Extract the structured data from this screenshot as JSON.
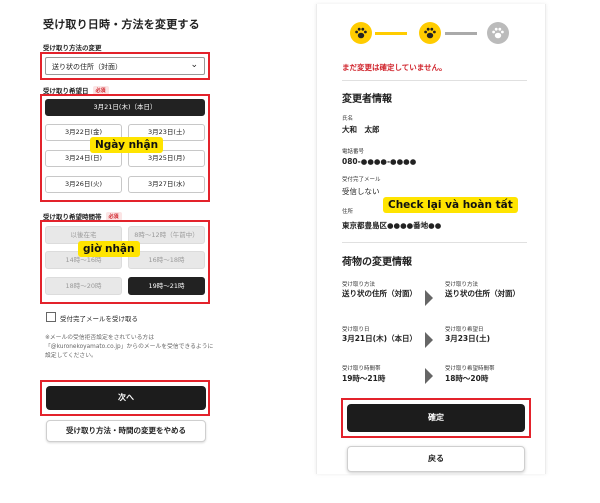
{
  "left": {
    "title": "受け取り日時・方法を変更する",
    "method_label": "受け取り方法の変更",
    "method_value": "送り状の住所（対面）",
    "date_label": "受け取り希望日",
    "required": "必須",
    "dates": [
      "3月21日(木)（本日）",
      "3月22日(金)",
      "3月23日(土)",
      "3月24日(日)",
      "3月25日(月)",
      "3月26日(火)",
      "3月27日(水)"
    ],
    "time_label": "受け取り希望時間帯",
    "times": [
      "以後在宅",
      "8時〜12時（午前中）",
      "14時〜16時",
      "16時〜18時",
      "18時〜20時",
      "19時〜21時"
    ],
    "overlay_date": "Ngày nhận",
    "overlay_time": "giờ nhận",
    "checkbox_label": "受付完了メールを受け取る",
    "note": "※メールの受信拒否設定をされている方は「@kuronekoyamato.co.jp」からのメールを受信できるように設定してください。",
    "next_label": "次へ",
    "cancel_label": "受け取り方法・時間の変更をやめる"
  },
  "right": {
    "warning": "まだ変更は確定していません。",
    "changer_title": "変更者情報",
    "name_label": "氏名",
    "name_value": "大和　太郎",
    "phone_label": "電話番号",
    "phone_value": "080-●●●●-●●●●",
    "mail_label": "受付完了メール",
    "mail_value": "受信しない",
    "address_label": "住所",
    "address_value": "東京都豊島区●●●●番地●●",
    "overlay_check": "Check lại và hoàn tất",
    "package_title": "荷物の変更情報",
    "method_label": "受け取り方法",
    "method_old": "送り状の住所（対面）",
    "method_new": "送り状の住所（対面）",
    "date_label": "受け取り日",
    "date_old": "3月21日(木)（本日）",
    "date_new_label": "受け取り希望日",
    "date_new": "3月23日(土)",
    "time_label": "受け取り時間帯",
    "time_old": "19時〜21時",
    "time_new_label": "受け取り希望時間帯",
    "time_new": "18時〜20時",
    "confirm_label": "確定",
    "back_label": "戻る"
  },
  "colors": {
    "accent_yellow": "#ffcc00",
    "highlight_red": "#e3222b",
    "step_inactive": "#aaaaaa",
    "button_dark": "#1c1c1c"
  },
  "icons": {
    "step": "paw-icon",
    "select": "chevron-down-icon",
    "compare": "arrow-right-icon"
  }
}
